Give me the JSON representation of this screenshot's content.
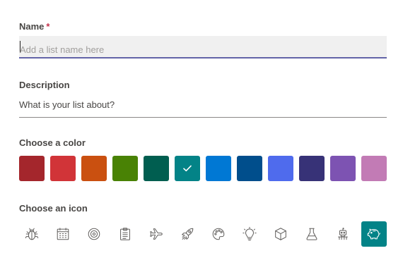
{
  "name": {
    "label": "Name",
    "required_mark": "*",
    "placeholder": "Add a list name here",
    "value": ""
  },
  "description": {
    "label": "Description",
    "placeholder": "What is your list about?",
    "value": ""
  },
  "color": {
    "label": "Choose a color",
    "selected_index": 5,
    "swatches": [
      "#a4262c",
      "#d13438",
      "#ca5010",
      "#498205",
      "#005e50",
      "#038387",
      "#0078d4",
      "#004e8c",
      "#4f6bed",
      "#373277",
      "#7d53b2",
      "#c27bb5"
    ]
  },
  "icon": {
    "label": "Choose an icon",
    "selected_index": 11,
    "selected_bg": "#038387",
    "items": [
      "bug-icon",
      "calendar-icon",
      "target-icon",
      "clipboard-icon",
      "airplane-icon",
      "rocket-icon",
      "palette-icon",
      "lightbulb-icon",
      "cube-icon",
      "flask-icon",
      "robot-icon",
      "piggy-bank-icon"
    ]
  }
}
